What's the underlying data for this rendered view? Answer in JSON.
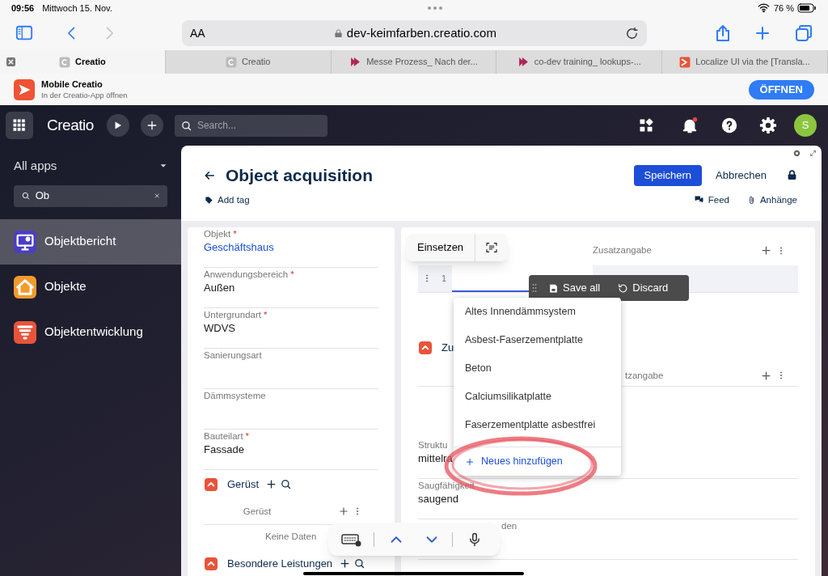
{
  "status_bar": {
    "time": "09:56",
    "date": "Mittwoch 15. Nov.",
    "battery": "76 %"
  },
  "browser": {
    "text_size": "AA",
    "url": "dev-keimfarben.creatio.com",
    "forward_disabled": true,
    "tabs": [
      {
        "title": "Creatio",
        "selected": true,
        "kind": "letter"
      },
      {
        "title": "Creatio",
        "selected": false,
        "kind": "letter"
      },
      {
        "title": "Messe Prozess_ Nach der...",
        "selected": false,
        "kind": "arrow"
      },
      {
        "title": "co-dev training_ lookups-...",
        "selected": false,
        "kind": "arrow"
      },
      {
        "title": "Localize UI via the [Transla...",
        "selected": false,
        "kind": "square"
      }
    ]
  },
  "app_banner": {
    "title": "Mobile Creatio",
    "subtitle": "In der Creatio-App öffnen",
    "button": "ÖFFNEN"
  },
  "top_bar": {
    "logo": "Creatio",
    "search_placeholder": "Search...",
    "avatar": "S"
  },
  "sidebar": {
    "title": "All apps",
    "search_value": "Ob",
    "items": [
      {
        "label": "Objektbericht",
        "selected": true,
        "color": "#4a3ec4",
        "kind": "report"
      },
      {
        "label": "Objekte",
        "selected": false,
        "color": "#f39a2c",
        "kind": "home"
      },
      {
        "label": "Objektentwicklung",
        "selected": false,
        "color": "#e8543a",
        "kind": "funnel"
      }
    ]
  },
  "page": {
    "title": "Object acquisition",
    "add_tag": "Add tag",
    "save": "Speichern",
    "cancel": "Abbrechen",
    "feed": "Feed",
    "attachments": "Anhänge"
  },
  "left_fields": [
    {
      "label": "Objekt",
      "required": true,
      "value": "Geschäftshaus",
      "link": true
    },
    {
      "label": "Anwendungsbereich",
      "required": true,
      "value": "Außen",
      "link": false
    },
    {
      "label": "Untergrundart",
      "required": true,
      "value": "WDVS",
      "link": false
    },
    {
      "label": "Sanierungsart",
      "required": false
    },
    {
      "label": "Dämmsysteme",
      "required": false
    },
    {
      "label": "Bauteilart",
      "required": true,
      "value": "Fassade",
      "link": false
    }
  ],
  "left_sections": [
    {
      "title": "Gerüst",
      "grid": {
        "column": "Gerüst",
        "empty": "Keine Daten"
      }
    },
    {
      "title": "Besondere Leistungen"
    }
  ],
  "right": {
    "grid": {
      "column": "Zusatzangabe",
      "row_number": "1"
    },
    "section": "Zu",
    "grid2": {
      "column": "tzangabe"
    },
    "fields": [
      {
        "label": "Struktu",
        "value": "mittelra",
        "kind": "plain"
      },
      {
        "label": "Saugfähigkeit",
        "value": "saugend",
        "kind": "plain"
      },
      {
        "label": "den",
        "kind": "covered"
      }
    ]
  },
  "required_mark": "*",
  "edit_menu": {
    "paste": "Einsetzen"
  },
  "save_bar": {
    "save": "Save all",
    "discard": "Discard"
  },
  "dropdown": {
    "options": [
      "Altes Innendämmsystem",
      "Asbest-Faserzementplatte",
      "Beton",
      "Calciumsilikatplatte",
      "Faserzementplatte asbestfrei"
    ],
    "add_new": "Neues hinzufügen"
  }
}
